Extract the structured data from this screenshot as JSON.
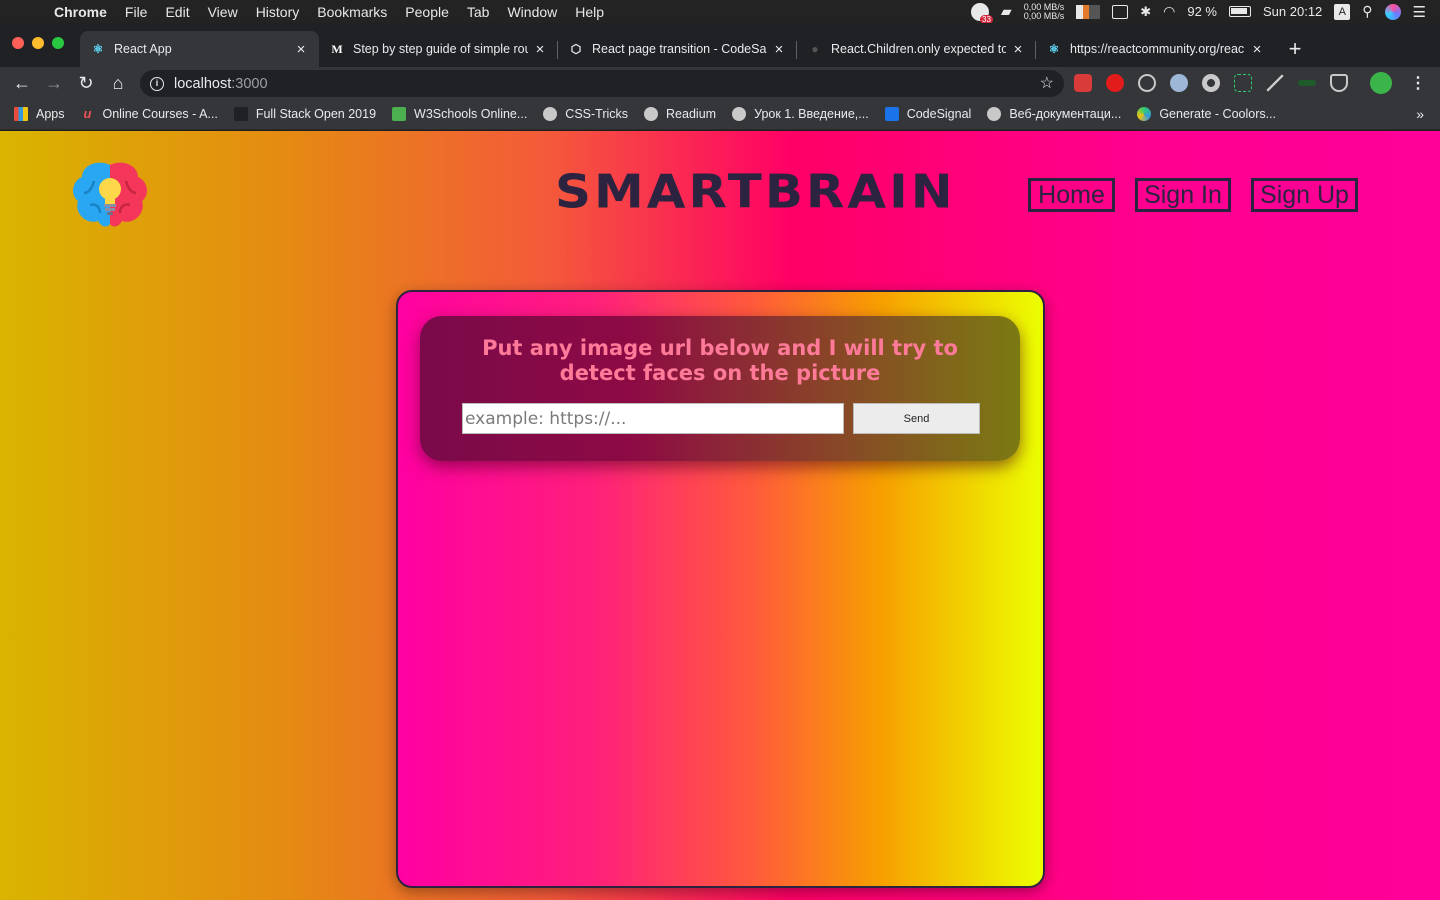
{
  "menubar": {
    "app": "Chrome",
    "items": [
      "File",
      "Edit",
      "View",
      "History",
      "Bookmarks",
      "People",
      "Tab",
      "Window",
      "Help"
    ],
    "status": {
      "badge_count": "33",
      "net_up": "0,00 MB/s",
      "net_down": "0,00 MB/s",
      "battery": "92 %",
      "clock": "Sun 20:12",
      "input_source": "A"
    }
  },
  "tabs": [
    {
      "title": "React App",
      "favicon": "react-icon",
      "active": true
    },
    {
      "title": "Step by step guide of simple rou",
      "favicon": "medium-icon",
      "active": false
    },
    {
      "title": "React page transition - CodeSan",
      "favicon": "codesandbox-icon",
      "active": false
    },
    {
      "title": "React.Children.only expected to",
      "favicon": "github-icon",
      "active": false
    },
    {
      "title": "https://reactcommunity.org/reac",
      "favicon": "react-icon",
      "active": false
    }
  ],
  "address": {
    "host": "localhost",
    "port": ":3000"
  },
  "bookmarks": [
    {
      "label": "Apps",
      "icon": "apps-grid-icon"
    },
    {
      "label": "Online Courses - A...",
      "icon": "udemy-icon"
    },
    {
      "label": "Full Stack Open 2019",
      "icon": "fullstack-icon"
    },
    {
      "label": "W3Schools Online...",
      "icon": "w3schools-icon"
    },
    {
      "label": "CSS-Tricks",
      "icon": "globe-icon"
    },
    {
      "label": "Readium",
      "icon": "globe-icon"
    },
    {
      "label": "Урок 1. Введение,...",
      "icon": "globe-icon"
    },
    {
      "label": "CodeSignal",
      "icon": "codesignal-icon"
    },
    {
      "label": "Веб-документаци...",
      "icon": "globe-icon"
    },
    {
      "label": "Generate - Coolors...",
      "icon": "coolors-icon"
    }
  ],
  "app": {
    "brand": "SMARTBRAIN",
    "nav": {
      "home": "Home",
      "sign_in": "Sign In",
      "sign_up": "Sign Up"
    },
    "headline": "Put any image url below and I will try to detect faces on the picture",
    "input_placeholder": "example: https://...",
    "input_value": "",
    "send_label": "Send",
    "colors": {
      "brand": "#2b2340",
      "headline": "#ff7a98"
    }
  }
}
